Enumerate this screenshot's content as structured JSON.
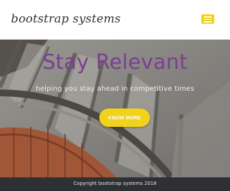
{
  "navbar": {
    "brand": "bootstrap systems",
    "toggle_icon": "hamburger-menu-icon",
    "toggle_color": "#f2d21a"
  },
  "hero": {
    "title": "Stay Relevant",
    "subtitle": "helping you stay ahead in competitive times",
    "cta_label": "KNOW MORE",
    "title_color": "#7b3f92",
    "cta_color": "#f2d21a"
  },
  "footer": {
    "copyright": "Copyright bootstrap systems 2018",
    "background": "#2f3033"
  }
}
